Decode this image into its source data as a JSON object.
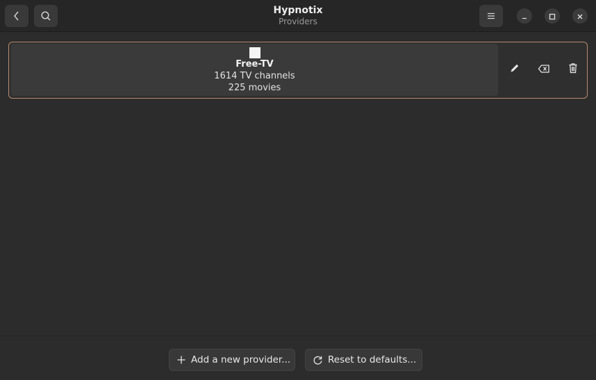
{
  "window": {
    "title": "Hypnotix",
    "subtitle": "Providers"
  },
  "header": {
    "back_icon": "chevron-left-icon",
    "search_icon": "search-icon",
    "menu_icon": "hamburger-menu-icon"
  },
  "window_controls": {
    "minimize_icon": "minimize-icon",
    "maximize_icon": "maximize-icon",
    "close_icon": "close-icon"
  },
  "providers": [
    {
      "name": "Free-TV",
      "channels": "1614 TV channels",
      "movies": "225 movies",
      "icon": "provider-logo-icon",
      "actions": [
        "edit-icon",
        "clear-icon",
        "trash-icon"
      ]
    }
  ],
  "footer": {
    "add_label": "Add a new provider...",
    "reset_label": "Reset to defaults...",
    "add_icon": "plus-icon",
    "reset_icon": "refresh-icon"
  },
  "colors": {
    "background": "#2c2c2c",
    "headerbar": "#262626",
    "selection_border": "#b88b6e",
    "card": "#3a3a3a"
  }
}
